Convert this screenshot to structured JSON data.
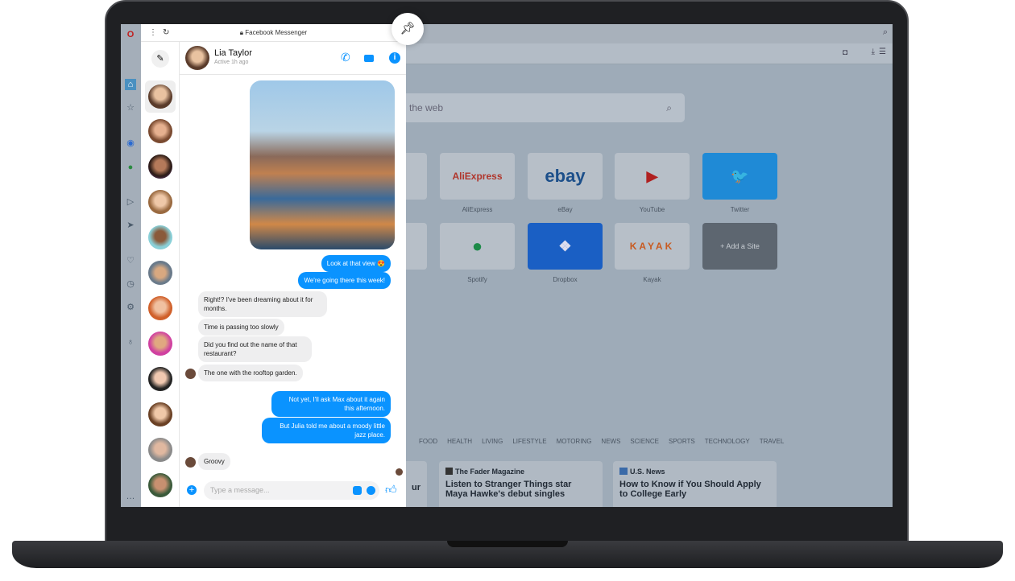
{
  "browser": {
    "search_placeholder": "the web",
    "speed_dial": [
      {
        "label": "AliExpress",
        "logo": "AliExpress",
        "color": "#e43225"
      },
      {
        "label": "eBay",
        "logo": "ebay",
        "color": "#0064d2"
      },
      {
        "label": "YouTube",
        "logo": "▶",
        "color": "#ff0000"
      },
      {
        "label": "Twitter",
        "logo": "🐦",
        "color": "#1da1f2"
      },
      {
        "label": "Spotify",
        "logo": "●",
        "color": "#1db954"
      },
      {
        "label": "Dropbox",
        "logo": "❖",
        "color": "#0061fe"
      },
      {
        "label": "Kayak",
        "logo": "KAYAK",
        "color": "#ff690f"
      },
      {
        "label": "",
        "logo": "+ Add a Site",
        "color": "#5d6670"
      }
    ],
    "categories": [
      "FOOD",
      "HEALTH",
      "LIVING",
      "LIFESTYLE",
      "MOTORING",
      "NEWS",
      "SCIENCE",
      "SPORTS",
      "TECHNOLOGY",
      "TRAVEL"
    ],
    "news": [
      {
        "source": "",
        "title": "ur"
      },
      {
        "source": "The Fader Magazine",
        "title": "Listen to Stranger Things star Maya Hawke's debut singles"
      },
      {
        "source": "U.S. News",
        "title": "How to Know if You Should Apply to College Early"
      }
    ]
  },
  "messenger": {
    "title": "Facebook Messenger",
    "contact": {
      "name": "Lia Taylor",
      "status": "Active 1h ago"
    },
    "accent": "#0a93ff",
    "messages": [
      {
        "from": "me",
        "text": "Look at that view 😍"
      },
      {
        "from": "me",
        "text": "We're going there this week!"
      },
      {
        "from": "them",
        "text": "Right!? I've been dreaming about it for months."
      },
      {
        "from": "them",
        "text": "Time is passing too slowly"
      },
      {
        "from": "them",
        "text": "Did you find out the name of that restaurant?"
      },
      {
        "from": "them",
        "text": "The one with the rooftop garden."
      },
      {
        "from": "me",
        "text": "Not yet, I'll ask Max about it again this afternoon."
      },
      {
        "from": "me",
        "text": "But Julia told me about a moody little jazz place."
      },
      {
        "from": "them",
        "text": "Groovy"
      }
    ],
    "input_placeholder": "Type a message..."
  }
}
